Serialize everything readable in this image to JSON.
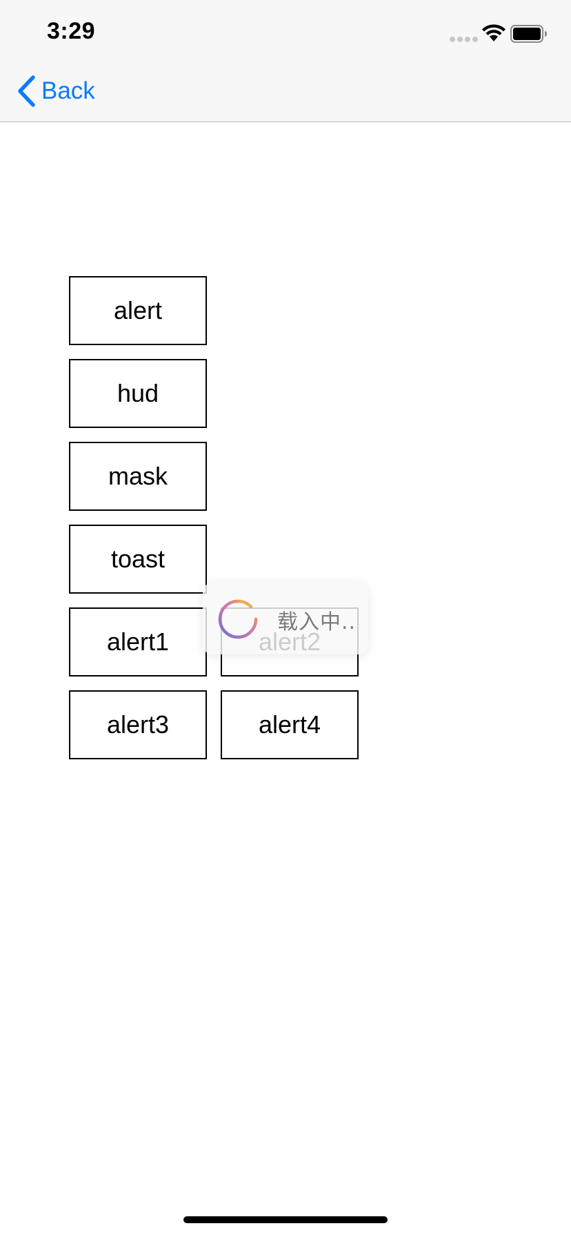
{
  "status_bar": {
    "time": "3:29"
  },
  "nav": {
    "back_label": "Back"
  },
  "buttons": {
    "alert": "alert",
    "hud": "hud",
    "mask": "mask",
    "toast": "toast",
    "alert1": "alert1",
    "alert2": "alert2",
    "alert3": "alert3",
    "alert4": "alert4"
  },
  "hud": {
    "text": "载入中.."
  },
  "colors": {
    "accent": "#0a7aff",
    "nav_background": "#f7f7f7",
    "button_border": "#000000"
  },
  "icons": {
    "back": "chevron-left-icon",
    "wifi": "wifi-icon",
    "battery": "battery-icon",
    "spinner": "loading-spinner-icon"
  }
}
